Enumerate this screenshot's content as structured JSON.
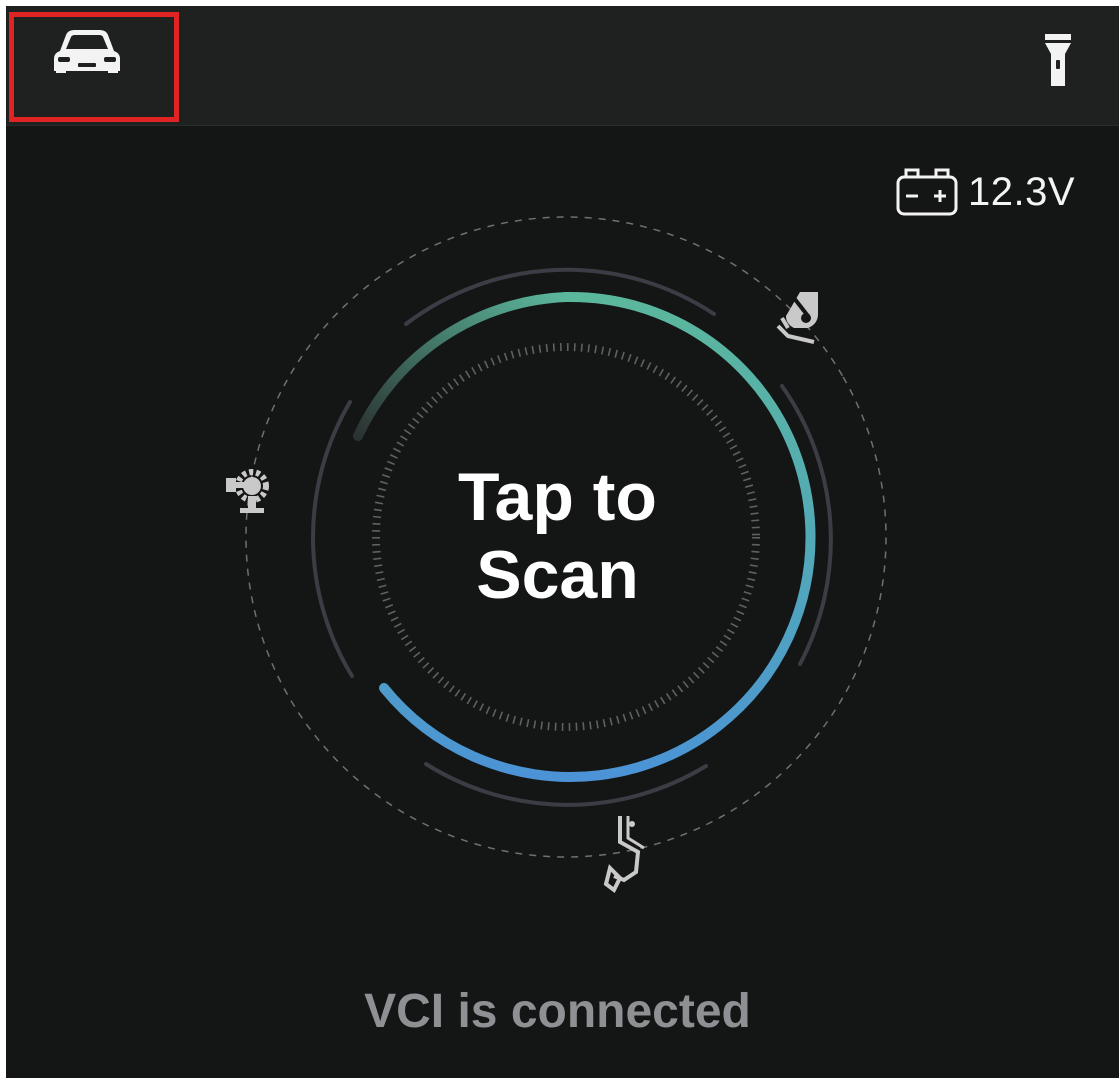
{
  "header": {
    "left_icon": "car-icon",
    "right_icon": "flashlight-icon"
  },
  "battery": {
    "icon": "battery-icon",
    "voltage": "12.3V"
  },
  "scan": {
    "line1": "Tap to",
    "line2": "Scan"
  },
  "mode_icons": [
    "wrench-gear-icon",
    "hand-wrench-icon",
    "exhaust-pipe-icon"
  ],
  "status": {
    "text": "VCI is connected"
  },
  "colors": {
    "background": "#141615",
    "topbar": "#1f2020",
    "highlight_box": "#e02424",
    "arc_green": "#5bb79c",
    "arc_blue": "#4b93d6",
    "status_text": "#8e9093"
  }
}
